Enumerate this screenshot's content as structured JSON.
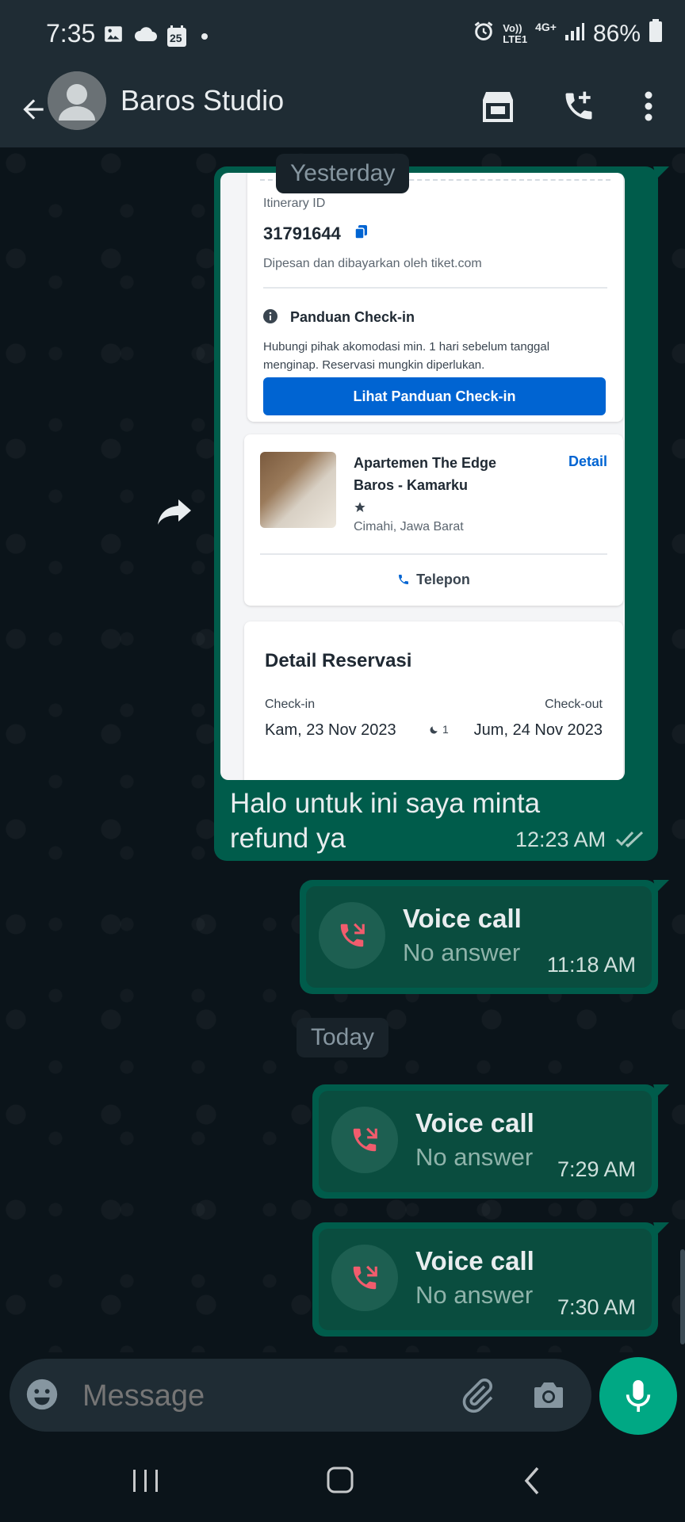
{
  "status_bar": {
    "time": "7:35",
    "calendar_day": "25",
    "network_top": "Vo))",
    "network_bottom": "LTE1",
    "network_type": "4G+",
    "battery": "86%"
  },
  "header": {
    "contact_name": "Baros Studio"
  },
  "messages": {
    "date_yesterday": "Yesterday",
    "date_today": "Today",
    "image_message": {
      "itinerary_label": "Itinerary ID",
      "itinerary_id": "31791644",
      "booked_by": "Dipesan dan dibayarkan oleh tiket.com",
      "checkin_guide_title": "Panduan Check-in",
      "checkin_guide_text": "Hubungi pihak akomodasi min. 1 hari sebelum tanggal menginap. Reservasi mungkin diperlukan.",
      "checkin_guide_button": "Lihat Panduan Check-in",
      "property_name": "Apartemen The Edge Baros - Kamarku",
      "property_location": "Cimahi, Jawa Barat",
      "detail_link": "Detail",
      "phone_label": "Telepon",
      "reservation_title": "Detail Reservasi",
      "checkin_label": "Check-in",
      "checkout_label": "Check-out",
      "checkin_date": "Kam, 23 Nov 2023",
      "nights": "1",
      "checkout_date": "Jum, 24 Nov 2023",
      "caption": "Halo untuk ini saya minta refund ya",
      "time": "12:23 AM"
    },
    "calls": [
      {
        "title": "Voice call",
        "status": "No answer",
        "time": "11:18 AM"
      },
      {
        "title": "Voice call",
        "status": "No answer",
        "time": "7:29 AM"
      },
      {
        "title": "Voice call",
        "status": "No answer",
        "time": "7:30 AM"
      }
    ]
  },
  "input": {
    "placeholder": "Message"
  },
  "colors": {
    "outgoing_bubble": "#005c4b",
    "accent": "#00a884",
    "missed_call": "#f15c6d",
    "tiket_blue": "#0064d2"
  }
}
